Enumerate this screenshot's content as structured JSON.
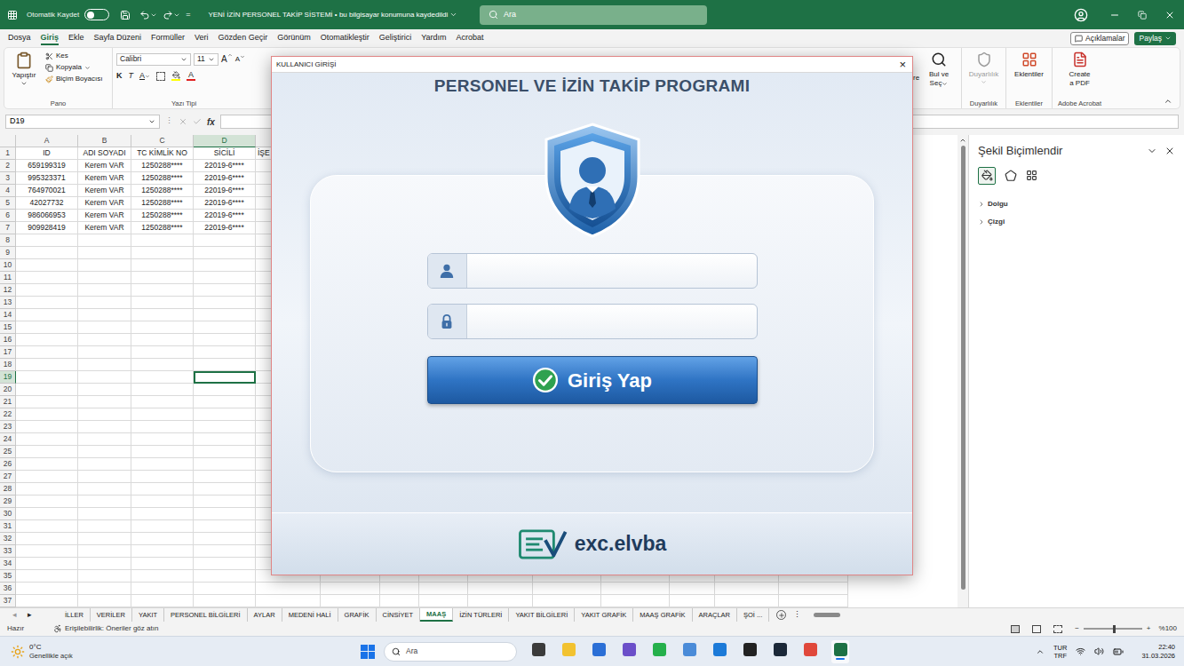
{
  "title_bar": {
    "autosave_label": "Otomatik Kaydet",
    "autosave_on": false,
    "qat_more": "=",
    "title": "YENİ İZİN PERSONEL TAKİP SİSTEMİ",
    "separator": "•",
    "save_status": "bu bilgisayar konumuna kaydedildi",
    "search_placeholder": "Ara"
  },
  "menu": {
    "tabs": [
      {
        "label": "Dosya",
        "selected": false
      },
      {
        "label": "Giriş",
        "selected": true
      },
      {
        "label": "Ekle",
        "selected": false
      },
      {
        "label": "Sayfa Düzeni",
        "selected": false
      },
      {
        "label": "Formüller",
        "selected": false
      },
      {
        "label": "Veri",
        "selected": false
      },
      {
        "label": "Gözden Geçir",
        "selected": false
      },
      {
        "label": "Görünüm",
        "selected": false
      },
      {
        "label": "Otomatikleştir",
        "selected": false
      },
      {
        "label": "Geliştirici",
        "selected": false
      },
      {
        "label": "Yardım",
        "selected": false
      },
      {
        "label": "Acrobat",
        "selected": false
      }
    ],
    "comments": "Açıklamalar",
    "share": "Paylaş"
  },
  "ribbon": {
    "paste": "Yapıştır",
    "cut": "Kes",
    "copy": "Kopyala",
    "format_painter": "Biçim Boyacısı",
    "clipboard_group": "Pano",
    "font_name": "Calibri",
    "font_size": "11",
    "font_grow": "A",
    "font_shrink": "A",
    "bold": "K",
    "italic": "T",
    "underline": "A",
    "font_color": "A",
    "font_group": "Yazı Tipi",
    "cut_off_label": "re",
    "find_select": [
      "Bul ve",
      "Seç"
    ],
    "sensitivity": {
      "label": "Duyarlılık",
      "disabled": true
    },
    "sensitivity_group": "Duyarlılık",
    "addins": "Eklentiler",
    "addins_group": "Eklentiler",
    "create_pdf": [
      "Create",
      "a PDF"
    ],
    "acrobat_group": "Adobe Acrobat"
  },
  "formula_bar": {
    "name_box": "D19",
    "separator": "⋮",
    "fx": "fx",
    "content": ""
  },
  "sheet": {
    "column_letters": [
      "A",
      "B",
      "C",
      "D"
    ],
    "row_numbers": [
      "1",
      "2",
      "3",
      "4",
      "5",
      "6",
      "7",
      "8",
      "9",
      "10",
      "11",
      "12",
      "13",
      "14",
      "15",
      "16",
      "17",
      "18",
      "19",
      "20",
      "21",
      "22",
      "23",
      "24",
      "25",
      "26",
      "27",
      "28",
      "29",
      "30",
      "31",
      "32",
      "33",
      "34",
      "35",
      "36",
      "37"
    ],
    "header": [
      "ID",
      "ADI SOYADI",
      "TC KİMLİK NO",
      "SİCİLİ",
      "İŞE"
    ],
    "rows": [
      [
        "659199319",
        "Kerem VAR",
        "1250288****",
        "22019-6****"
      ],
      [
        "995323371",
        "Kerem VAR",
        "1250288****",
        "22019-6****"
      ],
      [
        "764970021",
        "Kerem VAR",
        "1250288****",
        "22019-6****"
      ],
      [
        "42027732",
        "Kerem VAR",
        "1250288****",
        "22019-6****"
      ],
      [
        "986066953",
        "Kerem VAR",
        "1250288****",
        "22019-6****"
      ],
      [
        "909928419",
        "Kerem VAR",
        "1250288****",
        "22019-6****"
      ]
    ],
    "active_cell": {
      "column": "D",
      "row": "19"
    }
  },
  "format_pane": {
    "title": "Şekil Biçimlendir",
    "sections": [
      {
        "label": "Dolgu",
        "expanded": false
      },
      {
        "label": "Çizgi",
        "expanded": false
      }
    ]
  },
  "sheet_tabs": {
    "nav": [
      "◂",
      "▸"
    ],
    "tabs": [
      {
        "label": "İLLER",
        "selected": false
      },
      {
        "label": "VERİLER",
        "selected": false
      },
      {
        "label": "YAKIT",
        "selected": false
      },
      {
        "label": "PERSONEL BİLGİLERİ",
        "selected": false
      },
      {
        "label": "AYLAR",
        "selected": false
      },
      {
        "label": "MEDENİ HALİ",
        "selected": false
      },
      {
        "label": "GRAFİK",
        "selected": false
      },
      {
        "label": "CİNSİYET",
        "selected": false
      },
      {
        "label": "MAAŞ",
        "selected": true
      },
      {
        "label": "İZİN TÜRLERİ",
        "selected": false
      },
      {
        "label": "YAKIT BİLGİLERİ",
        "selected": false
      },
      {
        "label": "YAKIT GRAFİK",
        "selected": false
      },
      {
        "label": "MAAŞ GRAFİK",
        "selected": false
      },
      {
        "label": "ARAÇLAR",
        "selected": false
      },
      {
        "label": "ŞOİ ...",
        "selected": false
      }
    ],
    "more": "⋮"
  },
  "status_bar": {
    "ready": "Hazır",
    "accessibility": "Erişilebilirlik: Öneriler göz atın",
    "zoom_out": "−",
    "zoom_in": "+",
    "zoom": "%100",
    "zoom_level": 0.5
  },
  "taskbar": {
    "weather_temp": "0°C",
    "weather_desc": "Genellikle açık",
    "search_placeholder": "Ara",
    "apps": [
      {
        "active": false
      },
      {
        "active": false
      },
      {
        "active": false
      },
      {
        "active": false
      },
      {
        "active": false
      },
      {
        "active": false
      },
      {
        "active": false
      },
      {
        "active": false
      },
      {
        "active": false
      },
      {
        "active": false
      },
      {
        "active": true
      }
    ],
    "language": "TUR",
    "layout": "TRF",
    "time": "22:40",
    "date": "31.03.2026"
  },
  "dialog": {
    "title": "KULLANICI GİRİŞİ",
    "close": "×",
    "heading": "PERSONEL VE İZİN TAKİP PROGRAMI",
    "username": "",
    "password": "",
    "login_button": "Giriş Yap",
    "logo": "exc.elvba"
  }
}
